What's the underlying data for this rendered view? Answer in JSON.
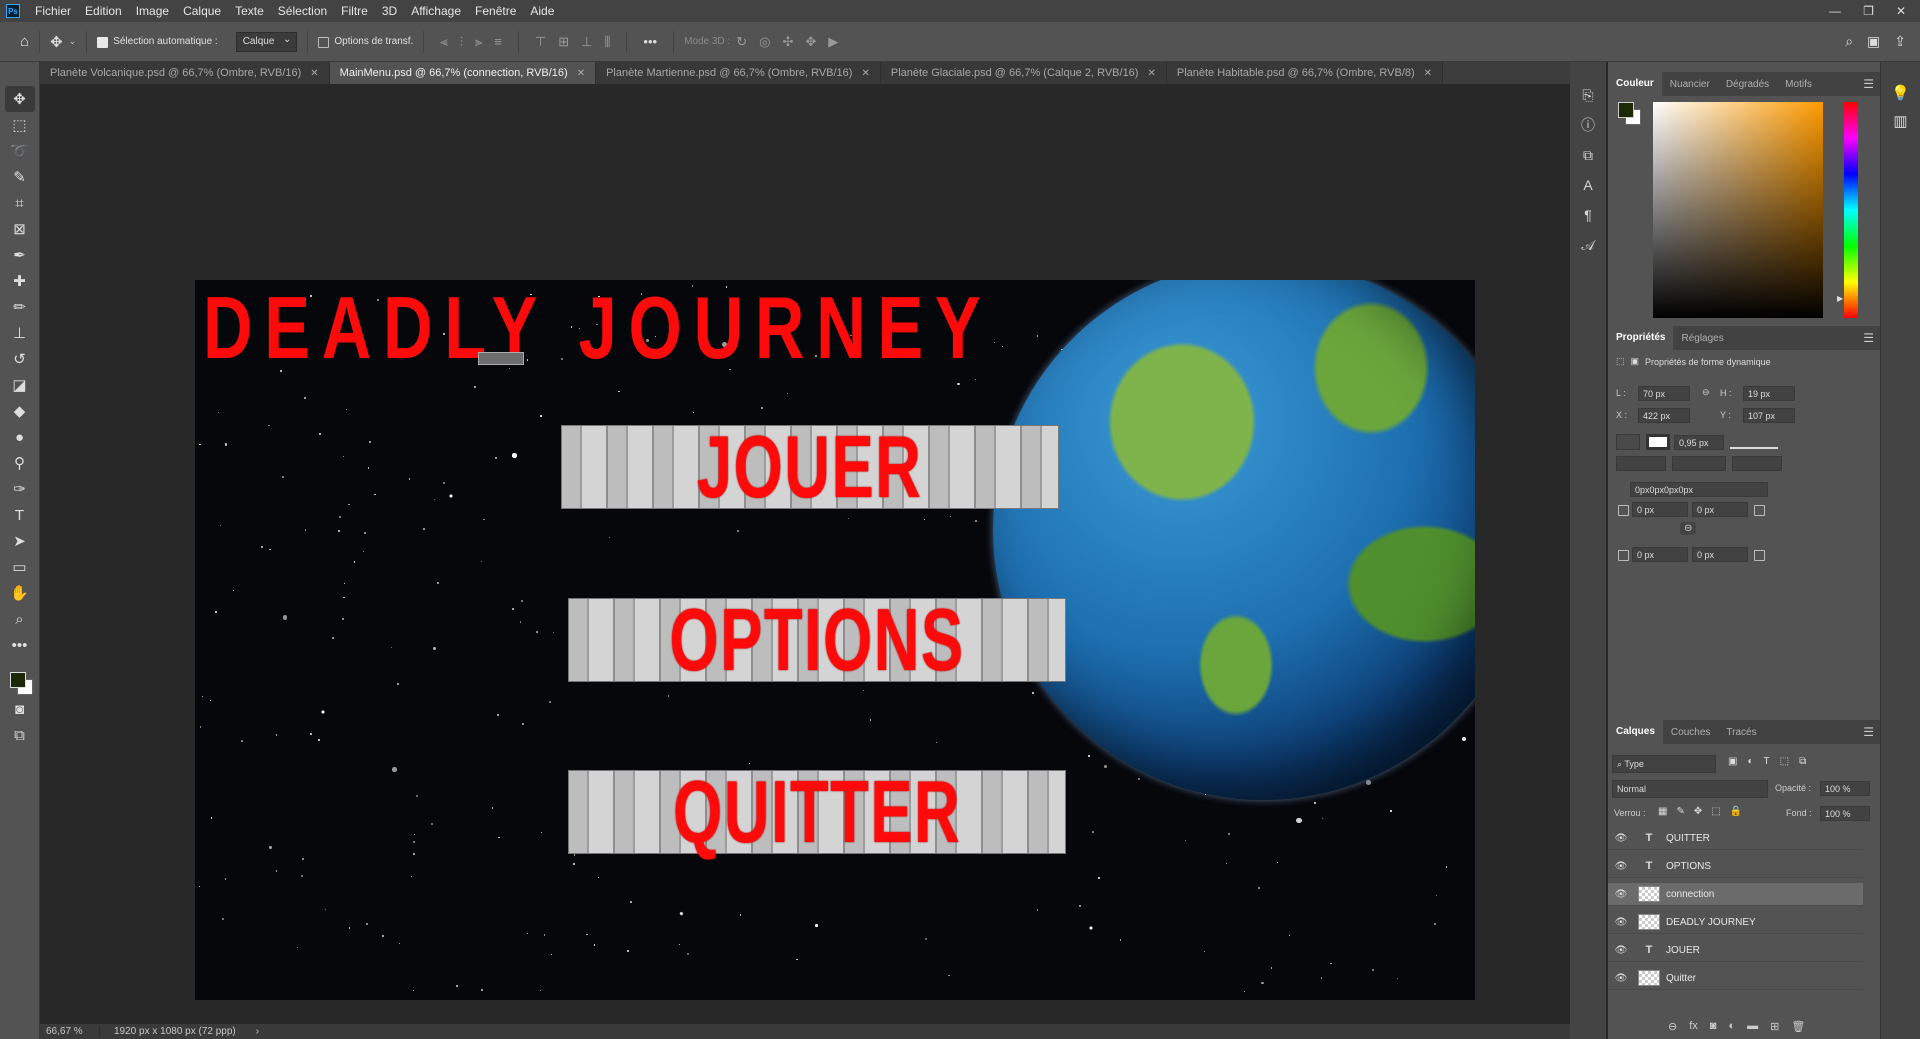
{
  "app": {
    "logo": "Ps"
  },
  "menubar": {
    "items": [
      "Fichier",
      "Edition",
      "Image",
      "Calque",
      "Texte",
      "Sélection",
      "Filtre",
      "3D",
      "Affichage",
      "Fenêtre",
      "Aide"
    ]
  },
  "options": {
    "auto_select_label": "Sélection automatique :",
    "auto_select_value": "Calque",
    "transform_label": "Options de transf.",
    "mode3d_label": "Mode 3D :"
  },
  "tabs": [
    {
      "label": "Planète Volcanique.psd @ 66,7% (Ombre, RVB/16)"
    },
    {
      "label": "MainMenu.psd @ 66,7% (connection, RVB/16)"
    },
    {
      "label": "Planète Martienne.psd @ 66,7% (Ombre, RVB/16)"
    },
    {
      "label": "Planète Glaciale.psd @ 66,7% (Calque 2, RVB/16)"
    },
    {
      "label": "Planète Habitable.psd @ 66,7% (Ombre, RVB/8)"
    }
  ],
  "canvas": {
    "title": "DEADLY JOURNEY",
    "buttons": [
      "JOUER",
      "OPTIONS",
      "QUITTER"
    ]
  },
  "status": {
    "zoom": "66,67 %",
    "doc_info": "1920 px x 1080 px (72 ppp)"
  },
  "color_panel": {
    "tabs": [
      "Couleur",
      "Nuancier",
      "Dégradés",
      "Motifs"
    ],
    "fg": "#1d2a0a",
    "bg": "#ffffff"
  },
  "properties_panel": {
    "tabs": [
      "Propriétés",
      "Réglages"
    ],
    "heading": "Propriétés de forme dynamique",
    "w_label": "L :",
    "w_value": "70 px",
    "h_label": "H :",
    "h_value": "19 px",
    "x_label": "X :",
    "x_value": "422 px",
    "y_label": "Y :",
    "y_value": "107 px",
    "stroke_value": "0,95 px",
    "radius_all": "0px0px0px0px",
    "r1": "0 px",
    "r2": "0 px",
    "r3": "0 px",
    "r4": "0 px"
  },
  "layers_panel": {
    "tabs": [
      "Calques",
      "Couches",
      "Tracés"
    ],
    "filter": "Type",
    "blend": "Normal",
    "opacity_label": "Opacité :",
    "opacity_value": "100 %",
    "lock_label": "Verrou :",
    "fill_label": "Fond :",
    "fill_value": "100 %",
    "layers": [
      {
        "name": "QUITTER",
        "kind": "text"
      },
      {
        "name": "OPTIONS",
        "kind": "text"
      },
      {
        "name": "connection",
        "kind": "smart",
        "selected": true
      },
      {
        "name": "DEADLY JOURNEY",
        "kind": "smart"
      },
      {
        "name": "JOUER",
        "kind": "text"
      },
      {
        "name": "Quitter",
        "kind": "smart"
      }
    ]
  }
}
